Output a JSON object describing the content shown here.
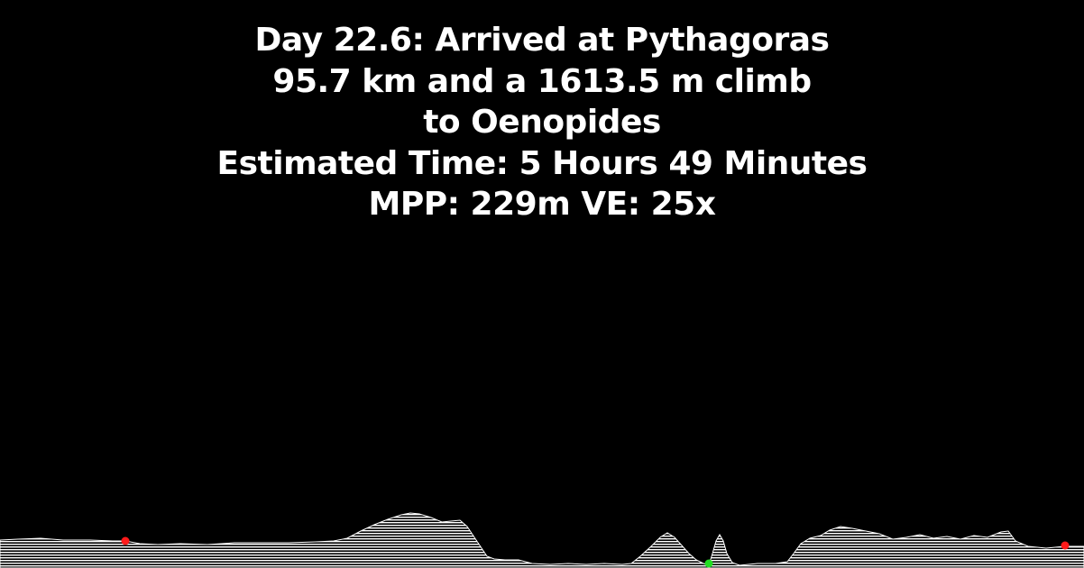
{
  "header": {
    "line1": "Day 22.6: Arrived at Pythagoras",
    "line2": "95.7 km and a 1613.5 m climb",
    "line3": "to Oenopides",
    "line4": "Estimated Time: 5 Hours 49 Minutes",
    "line5": "MPP: 229m VE: 25x"
  },
  "colors": {
    "background": "#000000",
    "text": "#ffffff",
    "terrain_fill": "#ffffff",
    "marker_end": "#ff1a1a",
    "marker_lowpoint": "#22dd22"
  }
}
